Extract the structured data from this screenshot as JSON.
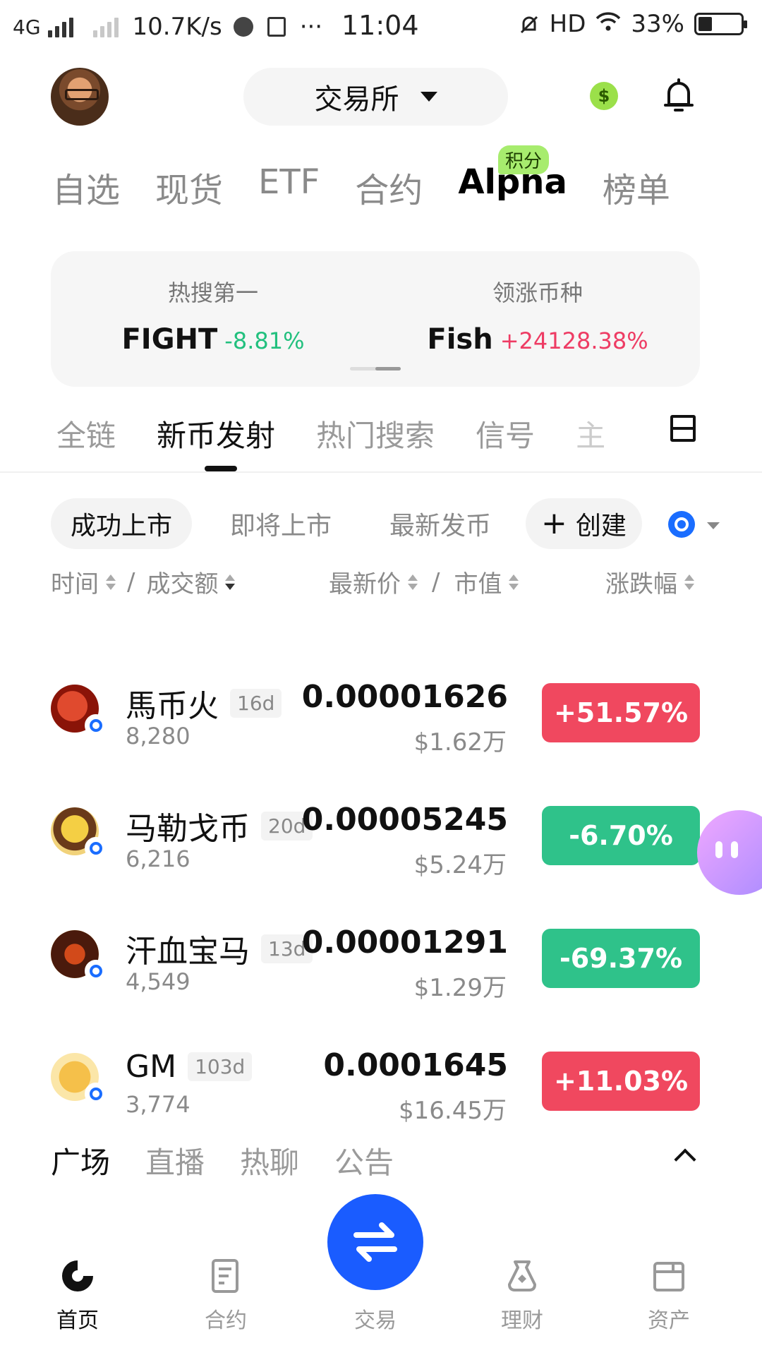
{
  "status_bar": {
    "network": "4G",
    "speed": "10.7K/s",
    "time": "11:04",
    "hd": "HD",
    "battery": "33%",
    "battery_level": 0.33,
    "dots": "···"
  },
  "header": {
    "selector_label": "交易所",
    "coin_symbol": "$"
  },
  "main_tabs": [
    "自选",
    "现货",
    "ETF",
    "合约",
    "Alpha",
    "榜单"
  ],
  "main_tab_active": "Alpha",
  "points_badge": "积分",
  "hot_card": {
    "left_label": "热搜第一",
    "left_symbol": "FIGHT",
    "left_change": "-8.81%",
    "right_label": "领涨币种",
    "right_symbol": "Fish",
    "right_change": "+24128.38%"
  },
  "sub_tabs": [
    "全链",
    "新币发射",
    "热门搜索",
    "信号",
    "主"
  ],
  "filters": {
    "items": [
      "成功上市",
      "即将上市",
      "最新发币"
    ],
    "create_label": "创建",
    "create_plus": "+"
  },
  "columns": {
    "time": "时间",
    "slash": "/",
    "volume": "成交额",
    "price": "最新价",
    "mcap": "市值",
    "change": "涨跌幅"
  },
  "tokens": [
    {
      "name": "馬币火",
      "age": "16d",
      "volume": "8,280",
      "price": "0.00001626",
      "mcap": "$1.62万",
      "change": "+51.57%",
      "direction": "up",
      "color": "#c0251b"
    },
    {
      "name": "马勒戈币",
      "age": "20d",
      "volume": "6,216",
      "price": "0.00005245",
      "mcap": "$5.24万",
      "change": "-6.70%",
      "direction": "down",
      "color": "#e8b020"
    },
    {
      "name": "汗血宝马",
      "age": "13d",
      "volume": "4,549",
      "price": "0.00001291",
      "mcap": "$1.29万",
      "change": "-69.37%",
      "direction": "down",
      "color": "#3a1a10"
    },
    {
      "name": "GM",
      "age": "103d",
      "volume": "3,774",
      "price": "0.0001645",
      "mcap": "$16.45万",
      "change": "+11.03%",
      "direction": "up",
      "color": "#f1d27a"
    }
  ],
  "feed_tabs": [
    "广场",
    "直播",
    "热聊",
    "公告"
  ],
  "bottom_nav": [
    {
      "label": "首页",
      "icon": "home-icon"
    },
    {
      "label": "合约",
      "icon": "contract-icon"
    },
    {
      "label": "交易",
      "icon": "trade-icon"
    },
    {
      "label": "理财",
      "icon": "finance-icon"
    },
    {
      "label": "资产",
      "icon": "wallet-icon"
    }
  ],
  "colors": {
    "up": "#f0485f",
    "down": "#2fc28a",
    "accent": "#1a5cff"
  }
}
